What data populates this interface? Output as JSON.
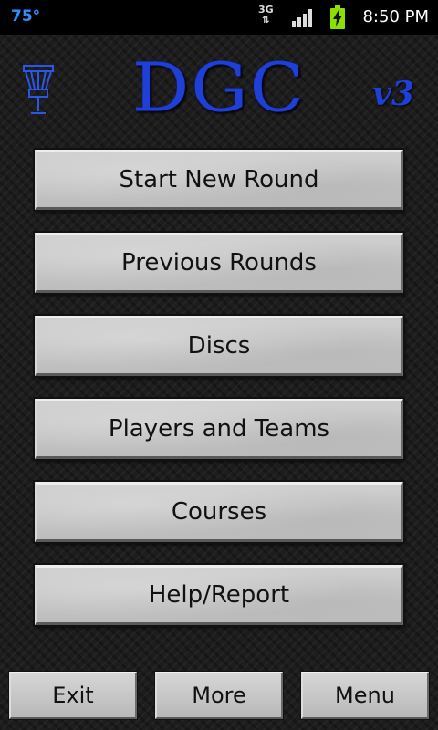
{
  "status": {
    "temperature": "75°",
    "network": "3G",
    "time": "8:50 PM"
  },
  "header": {
    "logo": "DGC",
    "version": "v3"
  },
  "menu": [
    {
      "label": "Start New Round"
    },
    {
      "label": "Previous Rounds"
    },
    {
      "label": "Discs"
    },
    {
      "label": "Players and Teams"
    },
    {
      "label": "Courses"
    },
    {
      "label": "Help/Report"
    }
  ],
  "bottom_bar": {
    "exit": "Exit",
    "more": "More",
    "menu": "Menu"
  },
  "colors": {
    "accent": "#1f3fd6",
    "status_temp": "#2f8fff",
    "battery": "#8be000"
  }
}
